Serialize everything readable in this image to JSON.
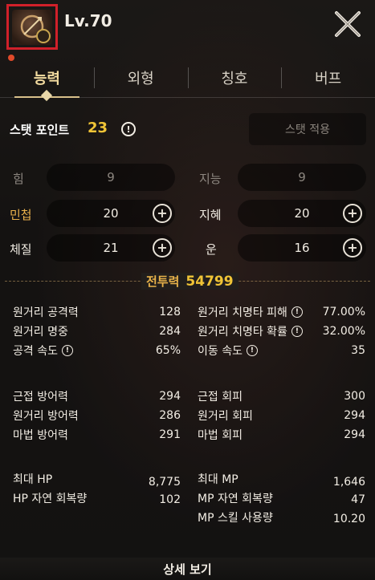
{
  "header": {
    "level": "Lv.70"
  },
  "tabs": [
    {
      "label": "능력",
      "active": true
    },
    {
      "label": "외형",
      "active": false
    },
    {
      "label": "칭호",
      "active": false
    },
    {
      "label": "버프",
      "active": false
    }
  ],
  "stat_points": {
    "label": "스탯 포인트",
    "value": "23",
    "apply_label": "스탯 적용"
  },
  "allocation": {
    "str": {
      "label": "힘",
      "value": "9"
    },
    "int": {
      "label": "지능",
      "value": "9"
    },
    "dex": {
      "label": "민첩",
      "value": "20"
    },
    "wis": {
      "label": "지혜",
      "value": "20"
    },
    "con": {
      "label": "체질",
      "value": "21"
    },
    "luk": {
      "label": "운",
      "value": "16"
    }
  },
  "combat_power": {
    "label": "전투력",
    "value": "54799"
  },
  "details": {
    "ranged_attack": {
      "label": "원거리 공격력",
      "value": "128"
    },
    "ranged_crit_damage": {
      "label": "원거리 치명타 피해",
      "value": "77.00%"
    },
    "ranged_accuracy": {
      "label": "원거리 명중",
      "value": "284"
    },
    "ranged_crit_rate": {
      "label": "원거리 치명타 확률",
      "value": "32.00%"
    },
    "attack_speed": {
      "label": "공격 속도",
      "value": "65%"
    },
    "move_speed": {
      "label": "이동 속도",
      "value": "35"
    },
    "melee_defense": {
      "label": "근접 방어력",
      "value": "294"
    },
    "melee_evasion": {
      "label": "근접 회피",
      "value": "300"
    },
    "ranged_defense": {
      "label": "원거리 방어력",
      "value": "286"
    },
    "ranged_evasion": {
      "label": "원거리 회피",
      "value": "294"
    },
    "magic_defense": {
      "label": "마법 방어력",
      "value": "291"
    },
    "magic_evasion": {
      "label": "마법 회피",
      "value": "294"
    },
    "max_hp": {
      "label": "최대 HP",
      "value": "8,775"
    },
    "max_mp": {
      "label": "최대 MP",
      "value": "1,646"
    },
    "hp_regen": {
      "label": "HP 자연 회복량",
      "value": "102"
    },
    "mp_regen": {
      "label": "MP 자연 회복량",
      "value": "47"
    },
    "mp_skill_cost": {
      "label": "MP 스킬 사용량",
      "value": "10.20"
    }
  },
  "footer": {
    "detail_button": "상세 보기"
  },
  "colors": {
    "accent_gold": "#f0c436",
    "accent_orange": "#ecb24c",
    "highlight_red": "#d1202a"
  }
}
